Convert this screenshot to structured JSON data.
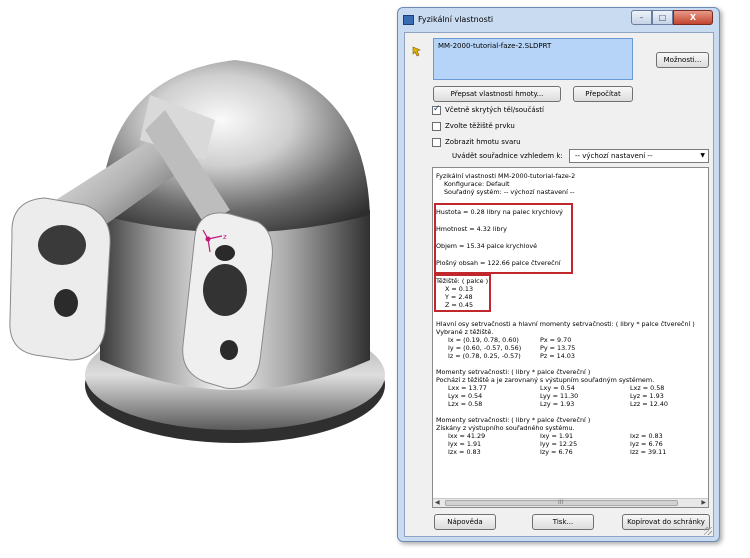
{
  "window": {
    "title": "Fyzikální vlastnosti",
    "minimize_glyph": "–",
    "maximize_glyph": "□",
    "close_glyph": "X"
  },
  "file": {
    "name": "MM-2000-tutorial-faze-2.SLDPRT"
  },
  "buttons": {
    "options": "Možnosti...",
    "override_mass": "Přepsat vlastnosti hmoty...",
    "recalculate": "Přepočítat",
    "help": "Nápověda",
    "print": "Tisk...",
    "copy": "Kopírovat do schránky"
  },
  "checkboxes": [
    {
      "label": "Včetně skrytých těl/součástí",
      "checked": true
    },
    {
      "label": "Zvolte těžiště prvku",
      "checked": false
    },
    {
      "label": "Zobrazit hmotu svaru",
      "checked": false
    }
  ],
  "coordinates": {
    "label": "Uvádět souřadnice vzhledem k:",
    "selected": "-- výchozí nastavení --"
  },
  "results": {
    "header": [
      "Fyzikální vlastnosti MM-2000-tutorial-faze-2",
      "Konfigurace: Default",
      "Souřadný systém: -- výchozí nastavení --"
    ],
    "density": "Hustota = 0.28 libry na  palec krychlový",
    "mass": "Hmotnost = 4.32 libry",
    "volume": "Objem = 15.34 palce krychlové",
    "area": "Plošný obsah = 122.66 palce čtvereční",
    "com_title": "Těžiště: ( palce )",
    "com": [
      "X = 0.13",
      "Y = 2.48",
      "Z = 0.45"
    ],
    "principal_title": "Hlavní osy setrvačnosti a hlavní momenty setrvačnosti: ( libry * palce čtvereční )",
    "principal_sub": "Vybrané z těžiště.",
    "principal_rows": [
      [
        "Ix = (0.19, 0.78, 0.60)",
        "Px = 9.70"
      ],
      [
        "Iy = (0.60, -0.57, 0.56)",
        "Py = 13.75"
      ],
      [
        "Iz = (0.78, 0.25, -0.57)",
        "Pz = 14.03"
      ]
    ],
    "moments_com_title": "Momenty setrvačnosti: ( libry * palce čtvereční )",
    "moments_com_sub": "Pochází z těžiště a je zarovnaný s výstupním souřadným systémem.",
    "moments_com_rows": [
      [
        "Lxx = 13.77",
        "Lxy = 0.54",
        "Lxz = 0.58"
      ],
      [
        "Lyx = 0.54",
        "Lyy = 11.30",
        "Lyz = 1.93"
      ],
      [
        "Lzx = 0.58",
        "Lzy = 1.93",
        "Lzz = 12.40"
      ]
    ],
    "moments_out_title": "Momenty setrvačnosti: ( libry * palce čtvereční )",
    "moments_out_sub": "Získány z výstupního souřadného systému.",
    "moments_out_rows": [
      [
        "Ixx = 41.29",
        "Ixy = 1.91",
        "Ixz = 0.83"
      ],
      [
        "Iyx = 1.91",
        "Iyy = 12.25",
        "Iyz = 6.76"
      ],
      [
        "Izx = 0.83",
        "Izy = 6.76",
        "Izz = 39.11"
      ]
    ],
    "scroll_grip": "III"
  },
  "viewport": {
    "triad_label": "z"
  },
  "colors": {
    "highlight": "#c0282d",
    "file_box": "#b5d4f7",
    "dialog_frame": "#c9dbf1"
  }
}
